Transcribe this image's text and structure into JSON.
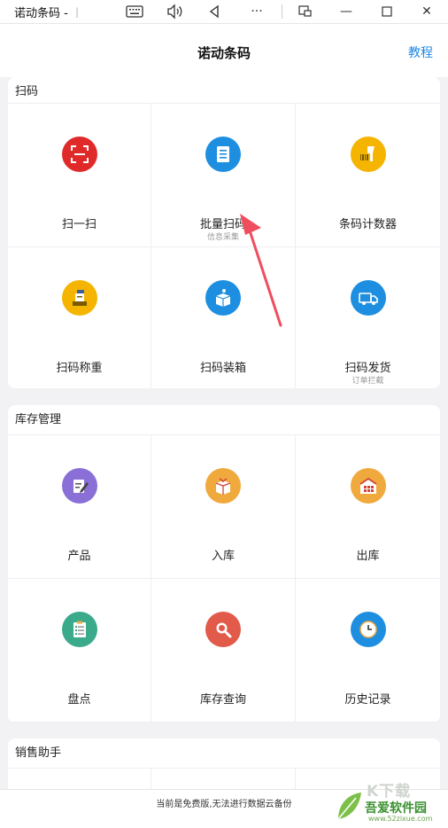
{
  "window": {
    "title": "诺动条码 -",
    "title_tail": "ㅣ",
    "icons": [
      "keyboard-icon",
      "volume-icon",
      "back-triangle-icon",
      "more-icon",
      "pip-icon",
      "minimize-icon",
      "maximize-icon",
      "close-icon"
    ],
    "more_glyph": "···",
    "minimize_glyph": "—",
    "close_glyph": "✕"
  },
  "header": {
    "title": "诺动条码",
    "help_link": "教程"
  },
  "sections": [
    {
      "title": "扫码",
      "items": [
        {
          "label": "扫一扫",
          "sub": "",
          "icon": "scan-icon",
          "color": "#e02a2a"
        },
        {
          "label": "批量扫码",
          "sub": "信息采集",
          "icon": "document-icon",
          "color": "#1e8fe0"
        },
        {
          "label": "条码计数器",
          "sub": "",
          "icon": "barcode-scanner-icon",
          "color": "#f4b400"
        },
        {
          "label": "扫码称重",
          "sub": "",
          "icon": "scale-icon",
          "color": "#f4b400"
        },
        {
          "label": "扫码装箱",
          "sub": "",
          "icon": "box-icon",
          "color": "#1e8fe0"
        },
        {
          "label": "扫码发货",
          "sub": "订单拦截",
          "icon": "truck-icon",
          "color": "#1e8fe0"
        }
      ]
    },
    {
      "title": "库存管理",
      "items": [
        {
          "label": "产品",
          "sub": "",
          "icon": "product-icon",
          "color": "#8a6fd6"
        },
        {
          "label": "入库",
          "sub": "",
          "icon": "inbound-box-icon",
          "color": "#f0a93c"
        },
        {
          "label": "出库",
          "sub": "",
          "icon": "warehouse-icon",
          "color": "#f0a93c"
        },
        {
          "label": "盘点",
          "sub": "",
          "icon": "checklist-icon",
          "color": "#3aaa8a"
        },
        {
          "label": "库存查询",
          "sub": "",
          "icon": "search-icon",
          "color": "#e25a4a"
        },
        {
          "label": "历史记录",
          "sub": "",
          "icon": "clock-icon",
          "color": "#1e8fe0"
        }
      ]
    },
    {
      "title": "销售助手",
      "items": []
    }
  ],
  "footer": {
    "notice": "当前是免费版,无法进行数据云备份"
  },
  "watermark": {
    "name": "吾爱软件园",
    "url": "www.52zixue.com",
    "top": "K下载"
  }
}
